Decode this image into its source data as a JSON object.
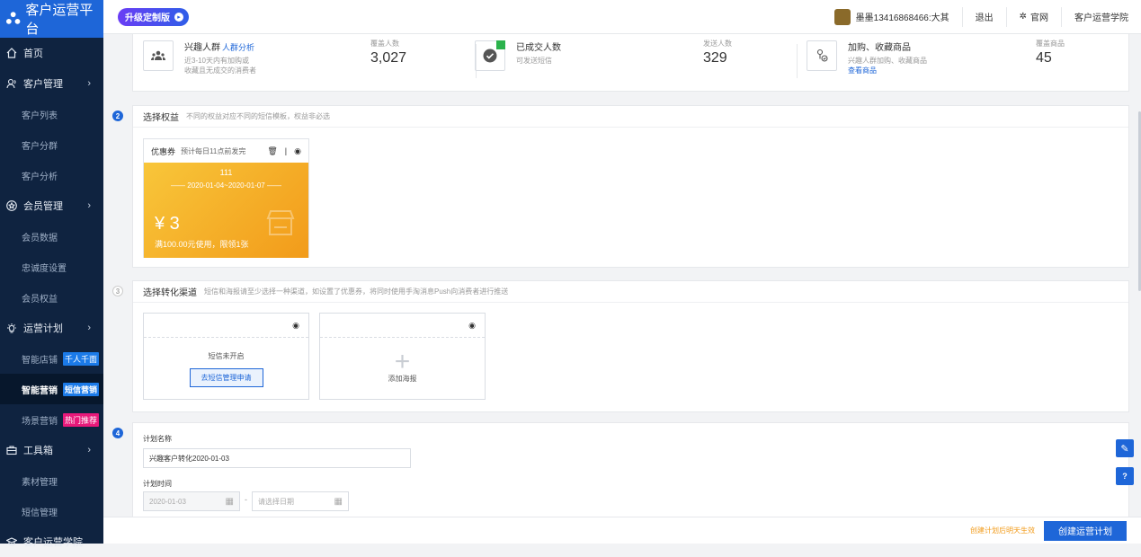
{
  "sidebar": {
    "logo": "客户运营平台",
    "items": [
      {
        "label": "首页",
        "type": "top",
        "icon": "home-icon"
      },
      {
        "label": "客户管理",
        "type": "top",
        "icon": "users-icon",
        "chevron": "›"
      },
      {
        "label": "客户列表",
        "type": "sub"
      },
      {
        "label": "客户分群",
        "type": "sub"
      },
      {
        "label": "客户分析",
        "type": "sub"
      },
      {
        "label": "会员管理",
        "type": "top",
        "icon": "star-icon",
        "chevron": "›"
      },
      {
        "label": "会员数据",
        "type": "sub"
      },
      {
        "label": "忠诚度设置",
        "type": "sub"
      },
      {
        "label": "会员权益",
        "type": "sub"
      },
      {
        "label": "运营计划",
        "type": "top",
        "icon": "bulb-icon",
        "chevron": "›"
      },
      {
        "label": "智能店铺",
        "type": "sub",
        "tag": "千人千面",
        "tagColor": "blue"
      },
      {
        "label": "智能营销",
        "type": "sub",
        "tag": "短信营销",
        "tagColor": "blue",
        "active": true
      },
      {
        "label": "场景营销",
        "type": "sub",
        "tag": "热门推荐",
        "tagColor": "red"
      },
      {
        "label": "工具箱",
        "type": "top",
        "icon": "toolbox-icon",
        "chevron": "›"
      },
      {
        "label": "素材管理",
        "type": "sub"
      },
      {
        "label": "短信管理",
        "type": "sub"
      },
      {
        "label": "客户运营学院",
        "type": "top",
        "icon": "graduation-icon"
      }
    ]
  },
  "topbar": {
    "upgrade_label": "升级定制版",
    "user": "墨墨13416868466:大其",
    "logout": "退出",
    "official_site": "官网",
    "academy": "客户运营学院"
  },
  "panel1": {
    "group1": {
      "title": "兴趣人群",
      "link": "人群分析",
      "desc1": "近3-10天内有加购或",
      "desc2": "收藏且无成交的消费者",
      "stat_label": "覆盖人数",
      "stat_value": "3,027"
    },
    "group2": {
      "title": "已成交人数",
      "desc1": "可发送短信",
      "stat_label": "发送人数",
      "stat_value": "329"
    },
    "group3": {
      "title": "加购、收藏商品",
      "desc1": "兴趣人群加购、收藏商品",
      "link": "查看商品",
      "stat_label": "覆盖商品",
      "stat_value": "45"
    }
  },
  "panel2": {
    "step": "2",
    "title": "选择权益",
    "desc": "不同的权益对应不同的短信模板，权益非必选",
    "coupon": {
      "type": "优惠券",
      "send_time": "预计每日11点前发完",
      "name": "111",
      "date_range": "—— 2020-01-04~2020-01-07 ——",
      "price": "¥ 3",
      "condition": "满100.00元使用，限领1张"
    }
  },
  "panel3": {
    "step": "3",
    "title": "选择转化渠道",
    "desc": "短信和海报请至少选择一种渠道，如设置了优惠券，将同时使用手淘消息Push向消费者进行推送",
    "sms_status": "短信未开启",
    "sms_button": "去短信管理申请",
    "poster_label": "添加海报"
  },
  "panel4": {
    "step": "4",
    "name_label": "计划名称",
    "name_value": "兴趣客户转化2020-01-03",
    "time_label": "计划时间",
    "start_date": "2020-01-03",
    "separator": "-",
    "end_placeholder": "请选择日期"
  },
  "bottombar": {
    "hint": "创建计划后明天生效",
    "create_button": "创建运营计划"
  }
}
